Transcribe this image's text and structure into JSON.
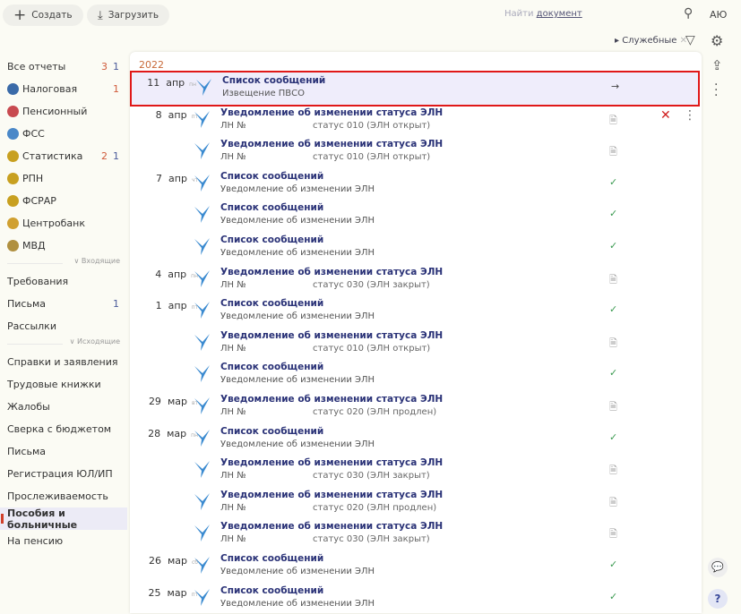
{
  "toolbar": {
    "create": "Создать",
    "upload": "Загрузить",
    "search_prefix": "Найти",
    "search_link": "документ",
    "user": "AЮ",
    "filter_tag": "Служебные"
  },
  "year": "2022",
  "sidebar": {
    "items": [
      {
        "label": "Все отчеты",
        "c1": "3",
        "c2": "1"
      },
      {
        "label": "Налоговая",
        "c2r": "1",
        "icon": "#3a6aa8"
      },
      {
        "label": "Пенсионный",
        "icon": "#c84a50"
      },
      {
        "label": "ФСС",
        "icon": "#4a88c8"
      },
      {
        "label": "Статистика",
        "c1": "2",
        "c2": "1",
        "icon": "#c8a020"
      },
      {
        "label": "РПН",
        "icon": "#c8a020"
      },
      {
        "label": "ФСРАР",
        "icon": "#c8a020"
      },
      {
        "label": "Центробанк",
        "icon": "#d0a030"
      },
      {
        "label": "МВД",
        "icon": "#b09040"
      }
    ],
    "incoming_label": "Входящие",
    "incoming": [
      {
        "label": "Требования"
      },
      {
        "label": "Письма",
        "c2": "1"
      },
      {
        "label": "Рассылки"
      }
    ],
    "outgoing_label": "Исходящие",
    "outgoing": [
      {
        "label": "Справки и заявления"
      },
      {
        "label": "Трудовые книжки"
      },
      {
        "label": "Жалобы"
      },
      {
        "label": "Сверка с бюджетом"
      },
      {
        "label": "Письма"
      },
      {
        "label": "Регистрация ЮЛ/ИП"
      },
      {
        "label": "Прослеживаемость"
      },
      {
        "label": "Пособия и больничные",
        "active": true
      },
      {
        "label": "На пенсию"
      }
    ]
  },
  "rows": [
    {
      "day": "11",
      "mon": "апр",
      "wd": "пн",
      "title": "Список сообщений",
      "sub": "Извещение ПВСО",
      "status": "",
      "mark": "arrow",
      "highlight": true
    },
    {
      "day": "8",
      "mon": "апр",
      "wd": "пт",
      "title": "Уведомление об изменении статуса ЭЛН",
      "sub": "ЛН №",
      "status": "статус 010 (ЭЛН открыт)",
      "mark": "doc",
      "actions": true
    },
    {
      "title": "Уведомление об изменении статуса ЭЛН",
      "sub": "ЛН №",
      "status": "статус 010 (ЭЛН открыт)",
      "mark": "doc"
    },
    {
      "day": "7",
      "mon": "апр",
      "wd": "чт",
      "title": "Список сообщений",
      "sub": "Уведомление об изменении ЭЛН",
      "mark": "check"
    },
    {
      "title": "Список сообщений",
      "sub": "Уведомление об изменении ЭЛН",
      "mark": "check"
    },
    {
      "title": "Список сообщений",
      "sub": "Уведомление об изменении ЭЛН",
      "mark": "check"
    },
    {
      "day": "4",
      "mon": "апр",
      "wd": "пн",
      "title": "Уведомление об изменении статуса ЭЛН",
      "sub": "ЛН №",
      "status": "статус 030 (ЭЛН закрыт)",
      "mark": "doc"
    },
    {
      "day": "1",
      "mon": "апр",
      "wd": "пт",
      "title": "Список сообщений",
      "sub": "Уведомление об изменении ЭЛН",
      "mark": "check"
    },
    {
      "title": "Уведомление об изменении статуса ЭЛН",
      "sub": "ЛН №",
      "status": "статус 010 (ЭЛН открыт)",
      "mark": "doc"
    },
    {
      "title": "Список сообщений",
      "sub": "Уведомление об изменении ЭЛН",
      "mark": "check"
    },
    {
      "day": "29",
      "mon": "мар",
      "wd": "вт",
      "title": "Уведомление об изменении статуса ЭЛН",
      "sub": "ЛН №",
      "status": "статус 020 (ЭЛН продлен)",
      "mark": "doc"
    },
    {
      "day": "28",
      "mon": "мар",
      "wd": "пн",
      "title": "Список сообщений",
      "sub": "Уведомление об изменении ЭЛН",
      "mark": "check"
    },
    {
      "title": "Уведомление об изменении статуса ЭЛН",
      "sub": "ЛН №",
      "status": "статус 030 (ЭЛН закрыт)",
      "mark": "doc"
    },
    {
      "title": "Уведомление об изменении статуса ЭЛН",
      "sub": "ЛН №",
      "status": "статус 020 (ЭЛН продлен)",
      "mark": "doc"
    },
    {
      "title": "Уведомление об изменении статуса ЭЛН",
      "sub": "ЛН №",
      "status": "статус 030 (ЭЛН закрыт)",
      "mark": "doc"
    },
    {
      "day": "26",
      "mon": "мар",
      "wd": "сб",
      "title": "Список сообщений",
      "sub": "Уведомление об изменении ЭЛН",
      "mark": "check"
    },
    {
      "day": "25",
      "mon": "мар",
      "wd": "пт",
      "title": "Список сообщений",
      "sub": "Уведомление об изменении ЭЛН",
      "mark": "check"
    }
  ]
}
